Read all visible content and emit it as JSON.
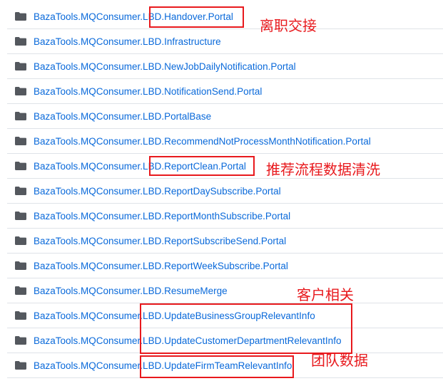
{
  "folder_icon": "folder-icon",
  "colors": {
    "link": "#0969da",
    "icon": "#54585e",
    "divider": "#dfe3e8",
    "annotation": "#e8191d"
  },
  "items": [
    {
      "name": "BazaTools.MQConsumer.LBD.Handover.Portal"
    },
    {
      "name": "BazaTools.MQConsumer.LBD.Infrastructure"
    },
    {
      "name": "BazaTools.MQConsumer.LBD.NewJobDailyNotification.Portal"
    },
    {
      "name": "BazaTools.MQConsumer.LBD.NotificationSend.Portal"
    },
    {
      "name": "BazaTools.MQConsumer.LBD.PortalBase"
    },
    {
      "name": "BazaTools.MQConsumer.LBD.RecommendNotProcessMonthNotification.Portal"
    },
    {
      "name": "BazaTools.MQConsumer.LBD.ReportClean.Portal"
    },
    {
      "name": "BazaTools.MQConsumer.LBD.ReportDaySubscribe.Portal"
    },
    {
      "name": "BazaTools.MQConsumer.LBD.ReportMonthSubscribe.Portal"
    },
    {
      "name": "BazaTools.MQConsumer.LBD.ReportSubscribeSend.Portal"
    },
    {
      "name": "BazaTools.MQConsumer.LBD.ReportWeekSubscribe.Portal"
    },
    {
      "name": "BazaTools.MQConsumer.LBD.ResumeMerge"
    },
    {
      "name": "BazaTools.MQConsumer.LBD.UpdateBusinessGroupRelevantInfo"
    },
    {
      "name": "BazaTools.MQConsumer.LBD.UpdateCustomerDepartmentRelevantInfo"
    },
    {
      "name": "BazaTools.MQConsumer.LBD.UpdateFirmTeamRelevantInfo"
    }
  ],
  "annotations": {
    "handover": "离职交接",
    "report_clean": "推荐流程数据清洗",
    "customer": "客户相关",
    "team": "团队数据"
  }
}
